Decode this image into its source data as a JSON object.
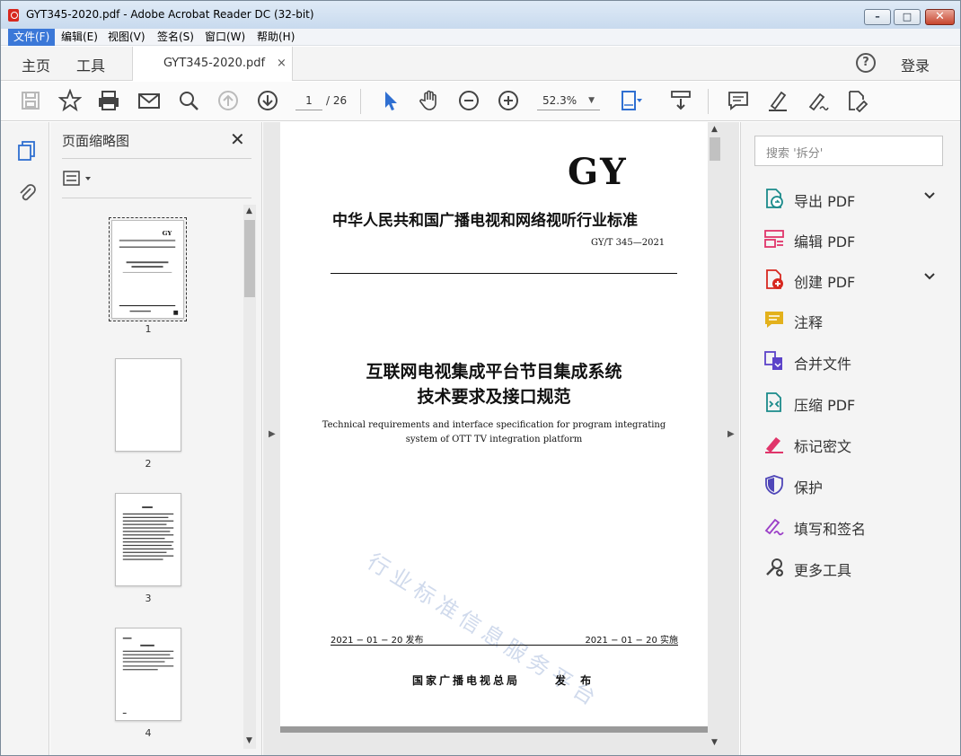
{
  "window": {
    "title": "GYT345-2020.pdf - Adobe Acrobat Reader DC (32-bit)",
    "min_glyph": "–",
    "max_glyph": "□",
    "close_glyph": "✕"
  },
  "menu": [
    {
      "label": "文件(F)",
      "active": true
    },
    {
      "label": "编辑(E)"
    },
    {
      "label": "视图(V)"
    },
    {
      "label": "签名(S)"
    },
    {
      "label": "窗口(W)"
    },
    {
      "label": "帮助(H)"
    }
  ],
  "tabs": {
    "home": "主页",
    "tools": "工具",
    "document": "GYT345-2020.pdf",
    "close_glyph": "×",
    "help_glyph": "?",
    "login": "登录"
  },
  "toolbar": {
    "page_current": "1",
    "page_total": "/ 26",
    "zoom": "52.3%",
    "zoom_caret": "▼",
    "icons": [
      "save-icon",
      "star-icon",
      "print-icon",
      "email-icon",
      "search-icon",
      "page-up-icon",
      "page-down-icon",
      "select-cursor-icon",
      "hand-icon",
      "zoom-out-icon",
      "zoom-in-icon",
      "fit-page-icon",
      "scroll-mode-icon",
      "comment-icon",
      "highlight-icon",
      "sign-icon",
      "edit-pdf-icon"
    ]
  },
  "thumbnails": {
    "title": "页面缩略图",
    "close_glyph": "✕",
    "pages": [
      {
        "num": "1",
        "selected": true
      },
      {
        "num": "2"
      },
      {
        "num": "3"
      },
      {
        "num": "4"
      }
    ]
  },
  "document": {
    "logo": "GY",
    "category": "中华人民共和国广播电视和网络视听行业标准",
    "standard_no": "GY/T  345—2021",
    "title_line1": "互联网电视集成平台节目集成系统",
    "title_line2": "技术要求及接口规范",
    "english_title": "Technical requirements and interface specification  for program integrating system of OTT TV integration platform",
    "watermark": "行业标准信息服务平台",
    "publish_date": "2021 − 01 − 20 发布",
    "effective_date": "2021 − 01 − 20 实施",
    "issuer": "国家广播电视总局",
    "publish_word": "发 布"
  },
  "right_pane": {
    "search_placeholder": "搜索 '拆分'",
    "tools": [
      {
        "label": "导出 PDF",
        "icon": "export-pdf-icon",
        "color": "#1a8a8a",
        "expand": true
      },
      {
        "label": "编辑 PDF",
        "icon": "edit-pdf-icon",
        "color": "#e0356a"
      },
      {
        "label": "创建 PDF",
        "icon": "create-pdf-icon",
        "color": "#d7281f",
        "expand": true
      },
      {
        "label": "注释",
        "icon": "comment-icon",
        "color": "#e3b11c"
      },
      {
        "label": "合并文件",
        "icon": "combine-files-icon",
        "color": "#5c43c9"
      },
      {
        "label": "压缩 PDF",
        "icon": "compress-pdf-icon",
        "color": "#1a8a8a"
      },
      {
        "label": "标记密文",
        "icon": "redact-icon",
        "color": "#e0356a"
      },
      {
        "label": "保护",
        "icon": "protect-icon",
        "color": "#4f46b8"
      },
      {
        "label": "填写和签名",
        "icon": "fill-sign-icon",
        "color": "#9b3fc7"
      },
      {
        "label": "更多工具",
        "icon": "more-tools-icon",
        "color": "#444444"
      }
    ]
  }
}
